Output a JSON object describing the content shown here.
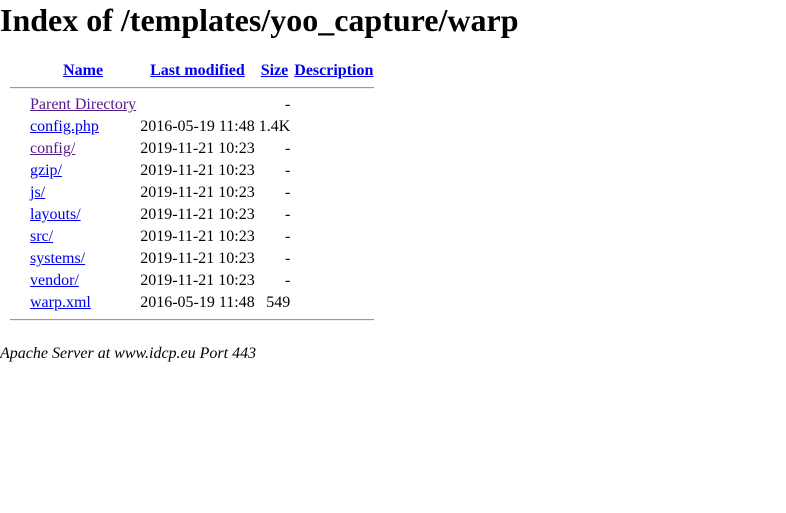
{
  "page": {
    "title": "Index of /templates/yoo_capture/warp"
  },
  "table": {
    "headers": {
      "name": "Name",
      "last_modified": "Last modified",
      "size": "Size",
      "description": "Description"
    },
    "rows": [
      {
        "name": "Parent Directory",
        "modified": "",
        "size": "-",
        "description": "",
        "visited": true
      },
      {
        "name": "config.php",
        "modified": "2016-05-19 11:48",
        "size": "1.4K",
        "description": "",
        "visited": false
      },
      {
        "name": "config/",
        "modified": "2019-11-21 10:23",
        "size": "-",
        "description": "",
        "visited": true
      },
      {
        "name": "gzip/",
        "modified": "2019-11-21 10:23",
        "size": "-",
        "description": "",
        "visited": false
      },
      {
        "name": "js/",
        "modified": "2019-11-21 10:23",
        "size": "-",
        "description": "",
        "visited": false
      },
      {
        "name": "layouts/",
        "modified": "2019-11-21 10:23",
        "size": "-",
        "description": "",
        "visited": false
      },
      {
        "name": "src/",
        "modified": "2019-11-21 10:23",
        "size": "-",
        "description": "",
        "visited": false
      },
      {
        "name": "systems/",
        "modified": "2019-11-21 10:23",
        "size": "-",
        "description": "",
        "visited": false
      },
      {
        "name": "vendor/",
        "modified": "2019-11-21 10:23",
        "size": "-",
        "description": "",
        "visited": false
      },
      {
        "name": "warp.xml",
        "modified": "2016-05-19 11:48",
        "size": "549",
        "description": "",
        "visited": false
      }
    ]
  },
  "footer": {
    "server_signature": "Apache Server at www.idcp.eu Port 443"
  },
  "colors": {
    "link": "#0000ee",
    "visited_link": "#551a8b",
    "rule": "#9a9a9a"
  }
}
